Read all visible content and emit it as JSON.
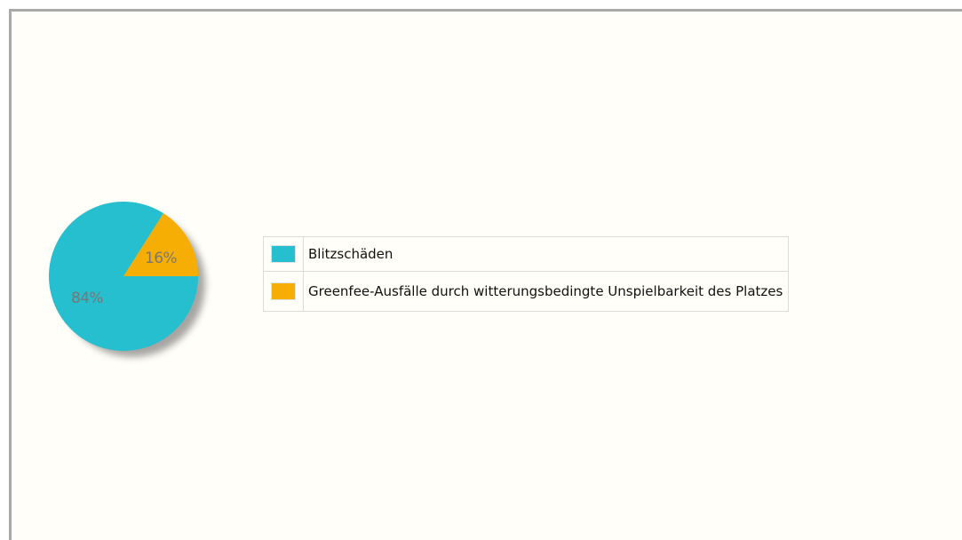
{
  "chart_data": {
    "type": "pie",
    "slices": [
      {
        "label": "Blitzschäden",
        "value": 84,
        "value_label": "84%",
        "color": "#25bfd0"
      },
      {
        "label": "Greenfee-Ausfälle durch witterungsbedingte Unspielbarkeit des Platzes",
        "value": 16,
        "value_label": "16%",
        "color": "#f6ae04"
      }
    ],
    "legend_position": "right",
    "shadow": true
  },
  "legend": {
    "items": [
      {
        "label": "Blitzschäden"
      },
      {
        "label": "Greenfee-Ausfälle durch witterungsbedingte Unspielbarkeit des Platzes"
      }
    ]
  }
}
